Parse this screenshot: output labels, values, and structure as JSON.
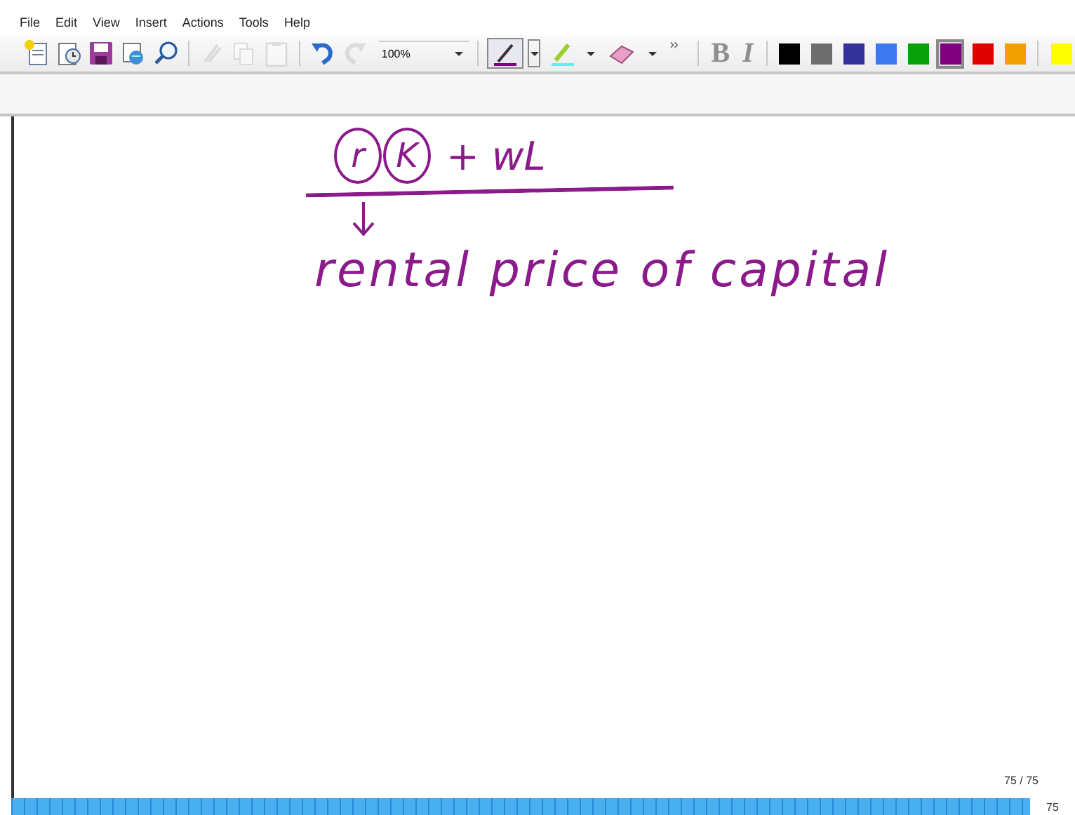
{
  "menu": [
    "File",
    "Edit",
    "View",
    "Insert",
    "Actions",
    "Tools",
    "Help"
  ],
  "toolbar": {
    "tools": [
      {
        "kind": "new",
        "disabled": false
      },
      {
        "kind": "template",
        "disabled": false
      },
      {
        "kind": "save",
        "disabled": false
      },
      {
        "kind": "send",
        "disabled": false
      },
      {
        "kind": "find",
        "disabled": false
      },
      {
        "kind": "sep"
      },
      {
        "kind": "cut",
        "disabled": true
      },
      {
        "kind": "copy",
        "disabled": true
      },
      {
        "kind": "paste",
        "disabled": true
      },
      {
        "kind": "sep"
      },
      {
        "kind": "undo",
        "disabled": false
      },
      {
        "kind": "redo",
        "disabled": true
      }
    ],
    "zoom": "100%",
    "pens": [
      {
        "kind": "pen",
        "selected": true
      },
      {
        "kind": "highlighter",
        "selected": false
      },
      {
        "kind": "eraser",
        "selected": false
      }
    ],
    "bold": {
      "label": "B",
      "disabled": true
    },
    "italic": {
      "label": "I",
      "disabled": true
    },
    "colors": [
      {
        "color": "#000000",
        "selected": false
      },
      {
        "color": "#6e6e6e",
        "selected": false
      },
      {
        "color": "#333399",
        "selected": false
      },
      {
        "color": "#3c78f0",
        "selected": false
      },
      {
        "color": "#0aa00a",
        "selected": false
      },
      {
        "color": "#800080",
        "selected": true
      },
      {
        "color": "#e00000",
        "selected": false
      },
      {
        "color": "#f0a000",
        "selected": false
      },
      {
        "color": "#ffff00",
        "selected": false
      }
    ]
  },
  "ink": {
    "color": "#8b1a8b",
    "circled": [
      "r",
      "K"
    ],
    "rest": "+ wL",
    "caption": "rental price of capital"
  },
  "page_indicator": "75 / 75",
  "page_bar_label": "75"
}
